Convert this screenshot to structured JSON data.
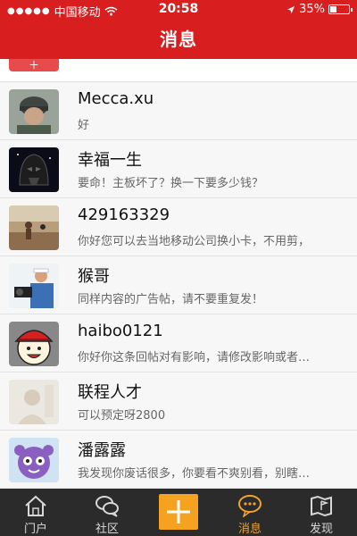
{
  "status_bar": {
    "carrier": "中国移动",
    "time": "20:58",
    "battery_text": "35%",
    "battery_level": 0.35,
    "icons": [
      "signal-dots-icon",
      "wifi-icon",
      "location-arrow-icon",
      "battery-icon"
    ]
  },
  "nav": {
    "title": "消息"
  },
  "messages": [
    {
      "name": "Mecca.xu",
      "text": "好",
      "avatar": "avatar-soldier"
    },
    {
      "name": "幸福一生",
      "text": "要命！主板坏了？换一下要多少钱？",
      "avatar": "avatar-darth-vader"
    },
    {
      "name": "429163329",
      "text": "你好您可以去当地移动公司换小卡，不用剪，",
      "avatar": "avatar-photo"
    },
    {
      "name": "猴哥",
      "text": "同样内容的广告帖，请不要重复发！",
      "avatar": "avatar-photographer"
    },
    {
      "name": "haibo0121",
      "text": "你好你这条回帖对有影响，请修改影响或者…",
      "avatar": "avatar-red-hat"
    },
    {
      "name": "联程人才",
      "text": "可以预定呀2800",
      "avatar": "avatar-faded"
    },
    {
      "name": "潘露露",
      "text": "我发现你废话很多，你要看不爽别看，别瞎…",
      "avatar": "avatar-purple-cartoon"
    }
  ],
  "tabs": [
    {
      "label": "门户",
      "icon": "house-icon",
      "active": false
    },
    {
      "label": "社区",
      "icon": "chat-bubbles-icon",
      "active": false
    },
    {
      "label": "",
      "icon": "plus-icon",
      "active": false
    },
    {
      "label": "消息",
      "icon": "message-bubble-icon",
      "active": true
    },
    {
      "label": "发现",
      "icon": "map-flag-icon",
      "active": false
    }
  ],
  "colors": {
    "header": "#d81e1e",
    "tab_bar": "#2b2b2b",
    "active_tab": "#f0a234",
    "add_button": "#f4a21f"
  }
}
